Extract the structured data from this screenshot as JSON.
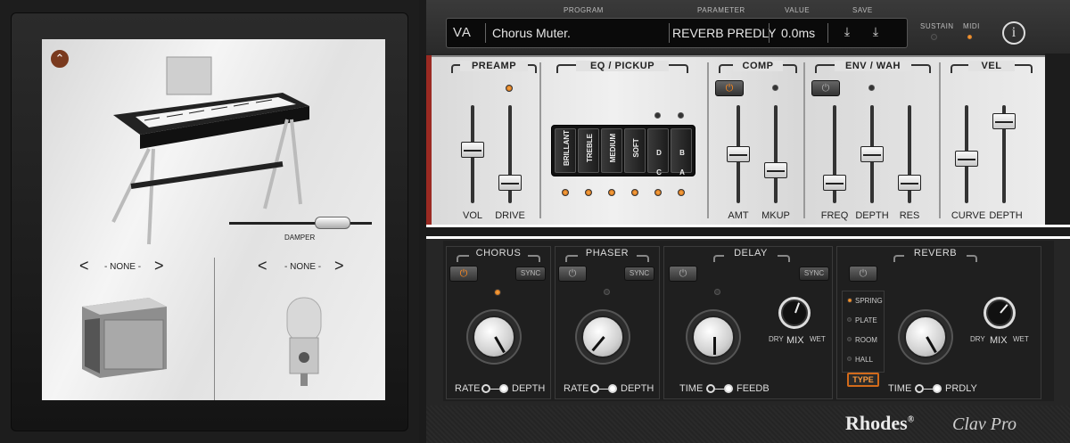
{
  "header": {
    "program_label": "PROGRAM",
    "parameter_label": "PARAMETER",
    "value_label": "VALUE",
    "save_label": "SAVE",
    "program_name": "Chorus Muter.",
    "parameter_name": "REVERB PREDLY",
    "parameter_value": "0.0ms",
    "sustain_label": "SUSTAIN",
    "midi_label": "MIDI",
    "info_label": "i",
    "logo_text": "VA"
  },
  "left_panel": {
    "damper_label": "DAMPER",
    "amp_selector": "- NONE -",
    "mic_selector": "- NONE -",
    "prev_glyph": "<",
    "next_glyph": ">"
  },
  "preamp": {
    "title": "PREAMP",
    "vol_label": "VOL",
    "drive_label": "DRIVE",
    "vol_level": 0.55,
    "drive_level": 0.15
  },
  "eq": {
    "title": "EQ / PICKUP",
    "buttons": [
      "BRILLANT",
      "TREBLE",
      "MEDIUM",
      "SOFT",
      "C",
      "A"
    ],
    "top_buttons": [
      "D",
      "B"
    ]
  },
  "comp": {
    "title": "COMP",
    "amt_label": "AMT",
    "mkup_label": "MKUP",
    "amt_level": 0.5,
    "mkup_level": 0.3
  },
  "envwah": {
    "title": "ENV / WAH",
    "freq_label": "FREQ",
    "depth_label": "DEPTH",
    "res_label": "RES",
    "freq_level": 0.15,
    "depth_level": 0.5,
    "res_level": 0.15
  },
  "vel": {
    "title": "VEL",
    "curve_label": "CURVE",
    "depth_label": "DEPTH",
    "curve_level": 0.45,
    "depth_level": 0.9
  },
  "chorus": {
    "title": "CHORUS",
    "sync_label": "SYNC",
    "rate_label": "RATE",
    "depth_label": "DEPTH"
  },
  "phaser": {
    "title": "PHASER",
    "sync_label": "SYNC",
    "rate_label": "RATE",
    "depth_label": "DEPTH"
  },
  "delay": {
    "title": "DELAY",
    "sync_label": "SYNC",
    "time_label": "TIME",
    "feedb_label": "FEEDB",
    "dry_label": "DRY",
    "mix_label": "MIX",
    "wet_label": "WET"
  },
  "reverb": {
    "title": "REVERB",
    "types": [
      "SPRING",
      "PLATE",
      "ROOM",
      "HALL"
    ],
    "type_button": "TYPE",
    "time_label": "TIME",
    "prdly_label": "PRDLY",
    "dry_label": "DRY",
    "mix_label": "MIX",
    "wet_label": "WET"
  },
  "branding": {
    "brand": "Rhodes",
    "model": "Clav Pro",
    "mark": "®"
  }
}
